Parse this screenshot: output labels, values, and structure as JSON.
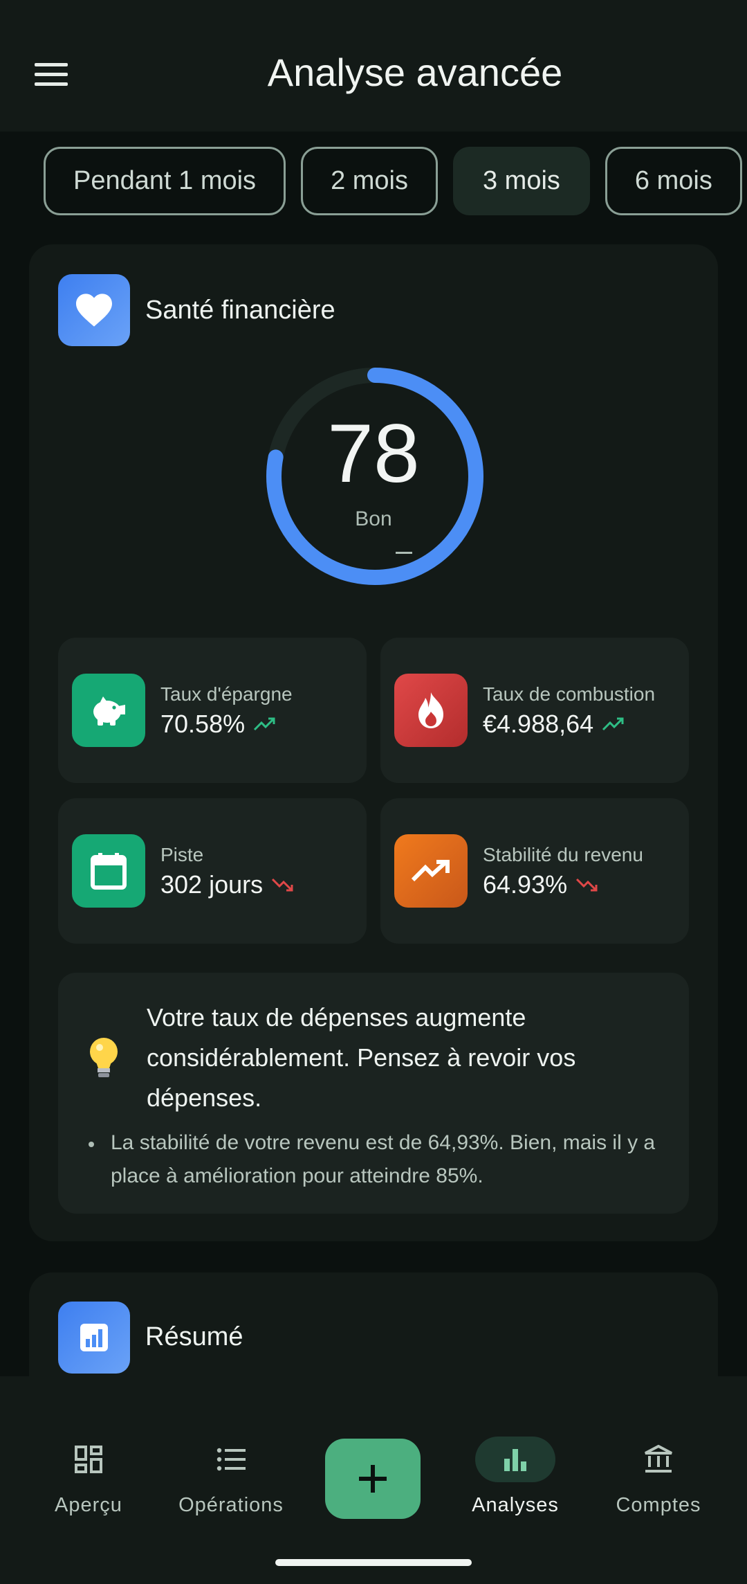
{
  "header": {
    "title": "Analyse avancée",
    "menu_icon": "hamburger-menu-icon"
  },
  "periods": [
    {
      "label": "Pendant 1 mois",
      "selected": false
    },
    {
      "label": "2 mois",
      "selected": false
    },
    {
      "label": "3 mois",
      "selected": true
    },
    {
      "label": "6 mois",
      "selected": false
    }
  ],
  "health": {
    "title": "Santé financière",
    "icon": "heart-icon",
    "score": "78",
    "score_fraction": 0.78,
    "rating": "Bon",
    "metrics": [
      {
        "label": "Taux d'épargne",
        "value": "70.58%",
        "trend": "up",
        "icon": "piggy-bank-icon",
        "color": "#16a874"
      },
      {
        "label": "Taux de combustion",
        "value": "€4.988,64",
        "trend": "up",
        "icon": "flame-icon",
        "color": "#d63c3c"
      },
      {
        "label": "Piste",
        "value": "302 jours",
        "trend": "down",
        "icon": "calendar-icon",
        "color": "#16a874"
      },
      {
        "label": "Stabilité du revenu",
        "value": "64.93%",
        "trend": "down",
        "icon": "trending-up-icon",
        "color": "#e8731d"
      }
    ],
    "tip": {
      "icon": "lightbulb-icon",
      "main": "Votre taux de dépenses augmente considérablement. Pensez à revoir vos dépenses.",
      "detail": "La stabilité de votre revenu est de 64,93%. Bien, mais il y a place à amélioration pour atteindre 85%."
    }
  },
  "summary": {
    "title": "Résumé",
    "icon": "report-chart-icon"
  },
  "nav": {
    "items": [
      {
        "label": "Aperçu",
        "icon": "dashboard-icon"
      },
      {
        "label": "Opérations",
        "icon": "list-icon"
      },
      {
        "label": "Analyses",
        "icon": "bar-chart-icon",
        "active": true
      },
      {
        "label": "Comptes",
        "icon": "bank-icon"
      }
    ],
    "fab_icon": "plus-icon"
  },
  "colors": {
    "accent": "#4c8ef5",
    "up": "#2ebd85",
    "down": "#e04848",
    "fab": "#4caf7f"
  }
}
